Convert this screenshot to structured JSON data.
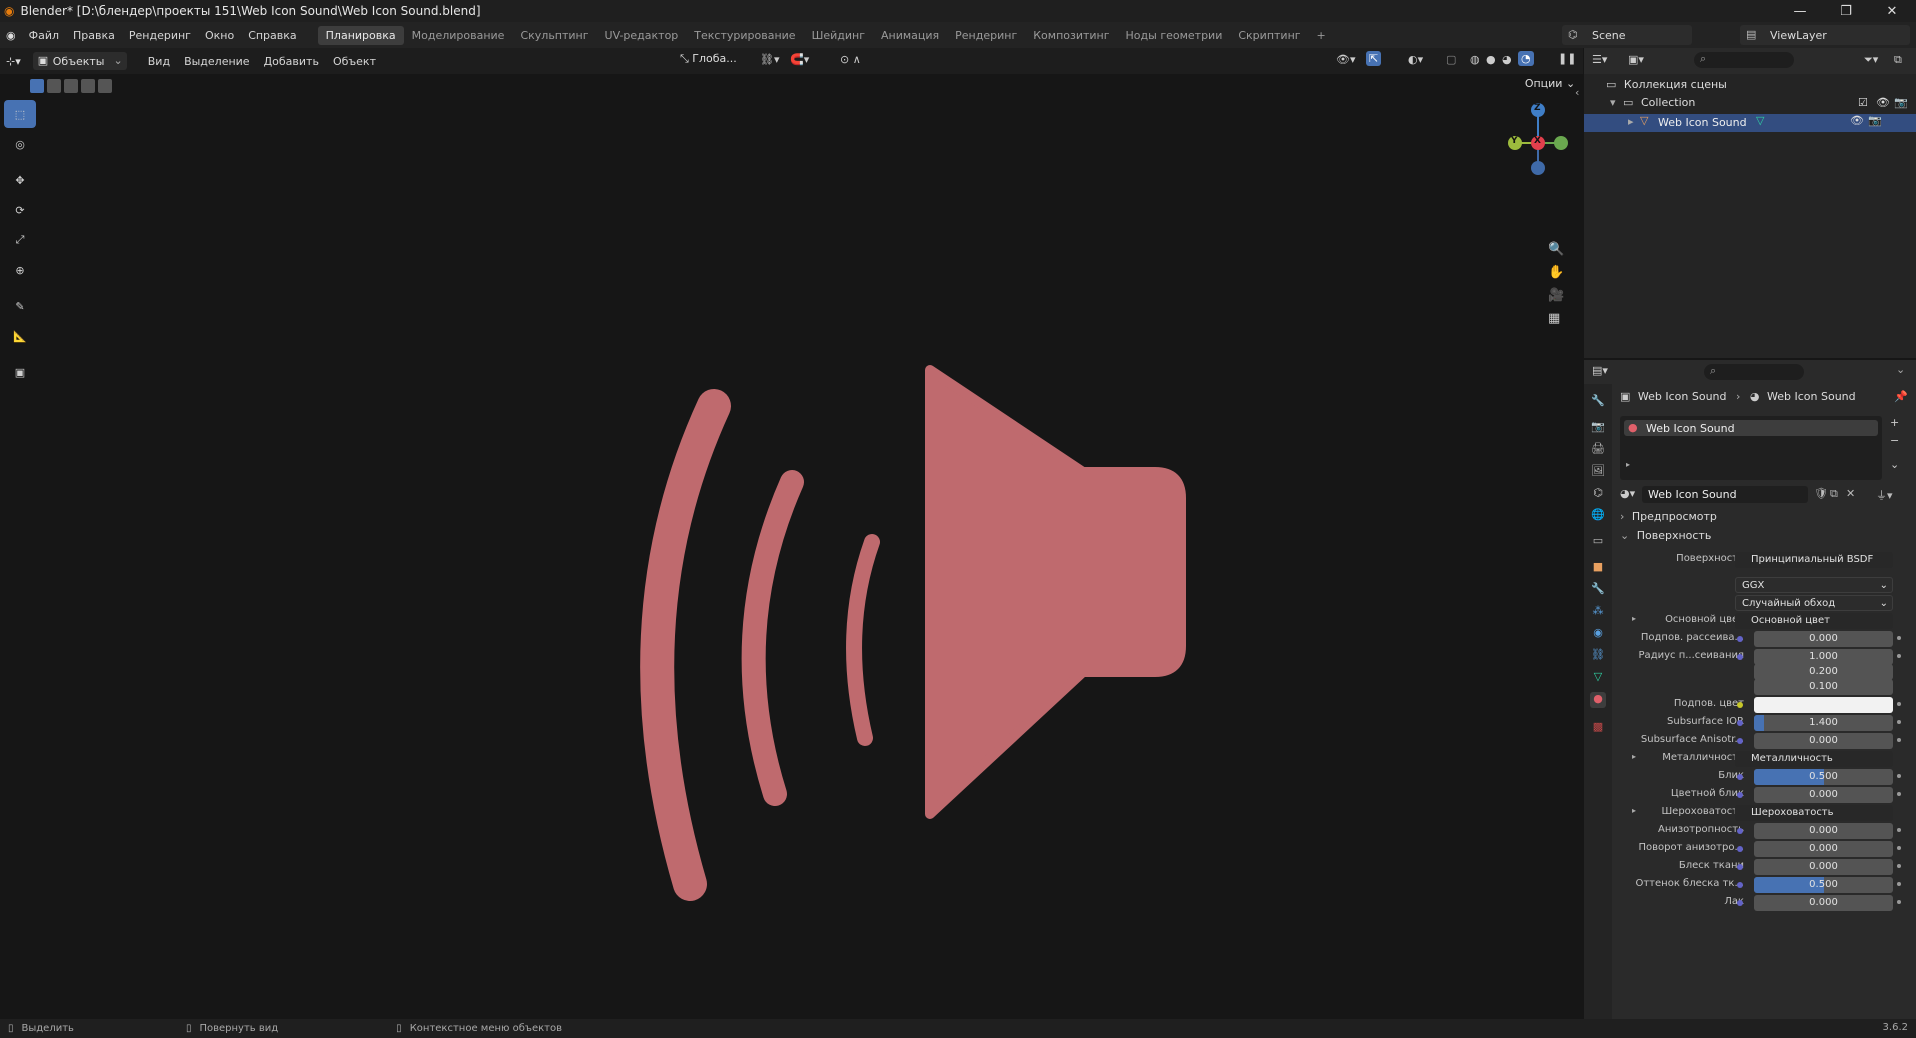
{
  "window": {
    "title": "Blender* [D:\\блендер\\проекты 151\\Web Icon Sound\\Web Icon Sound.blend]"
  },
  "menu": {
    "items": [
      "Файл",
      "Правка",
      "Рендеринг",
      "Окно",
      "Справка"
    ]
  },
  "workspaces": [
    "Планировка",
    "Моделирование",
    "Скульптинг",
    "UV-редактор",
    "Текстурирование",
    "Шейдинг",
    "Анимация",
    "Рендеринг",
    "Композитинг",
    "Ноды геометрии",
    "Скриптинг"
  ],
  "scene": {
    "name": "Scene",
    "view_layer": "ViewLayer"
  },
  "viewport_header": {
    "mode": "Объекты",
    "view": "Вид",
    "select": "Выделение",
    "add": "Добавить",
    "object": "Объект",
    "orientation": "Глоба...",
    "options": "Опции"
  },
  "gizmo": {
    "z": "Z",
    "x": "X",
    "y": "Y"
  },
  "outliner": {
    "root": "Коллекция сцены",
    "collection": "Collection",
    "object": "Web Icon Sound"
  },
  "properties": {
    "breadcrumb_object": "Web Icon Sound",
    "breadcrumb_material": "Web Icon Sound",
    "slot": "Web Icon Sound",
    "material_name": "Web Icon Sound",
    "preview": "Предпросмотр",
    "surface_panel": "Поверхность",
    "surface_label": "Поверхность",
    "surface_value": "Принципиальный BSDF",
    "distribution": "GGX",
    "subsurface_method": "Случайный обход",
    "base_color_label": "Основной цвет",
    "base_color_value": "Основной цвет",
    "ss_label": "Подпов. рассеива...",
    "ss_value": "0.000",
    "ssr_label": "Радиус п...сеивания",
    "ssr_1": "1.000",
    "ssr_2": "0.200",
    "ssr_3": "0.100",
    "ssc_label": "Подпов. цвет",
    "ior_label": "Subsurface IOR",
    "ior_value": "1.400",
    "aniso_ss_label": "Subsurface Anisotr...",
    "aniso_ss_value": "0.000",
    "metal_label": "Металличность",
    "metal_value": "Металличность",
    "spec_label": "Блик",
    "spec_value": "0.500",
    "spec_tint_label": "Цветной блик",
    "spec_tint_value": "0.000",
    "rough_label": "Шероховатость",
    "rough_value": "Шероховатость",
    "aniso_label": "Анизотропность",
    "aniso_value": "0.000",
    "aniso_rot_label": "Поворот анизотро...",
    "aniso_rot_value": "0.000",
    "sheen_label": "Блеск ткани",
    "sheen_value": "0.000",
    "sheen_tint_label": "Оттенок блеска тк...",
    "sheen_tint_value": "0.500",
    "clearcoat_label": "Лак",
    "clearcoat_value": "0.000"
  },
  "levels": {
    "ior": 0.07,
    "spec": 0.5,
    "sheen_tint": 0.5
  },
  "status": {
    "select": "Выделить",
    "rotate": "Повернуть вид",
    "context": "Контекстное меню объектов",
    "version": "3.6.2"
  },
  "colors": {
    "accent": "#4772b3",
    "mesh": "#bf6a6e"
  }
}
